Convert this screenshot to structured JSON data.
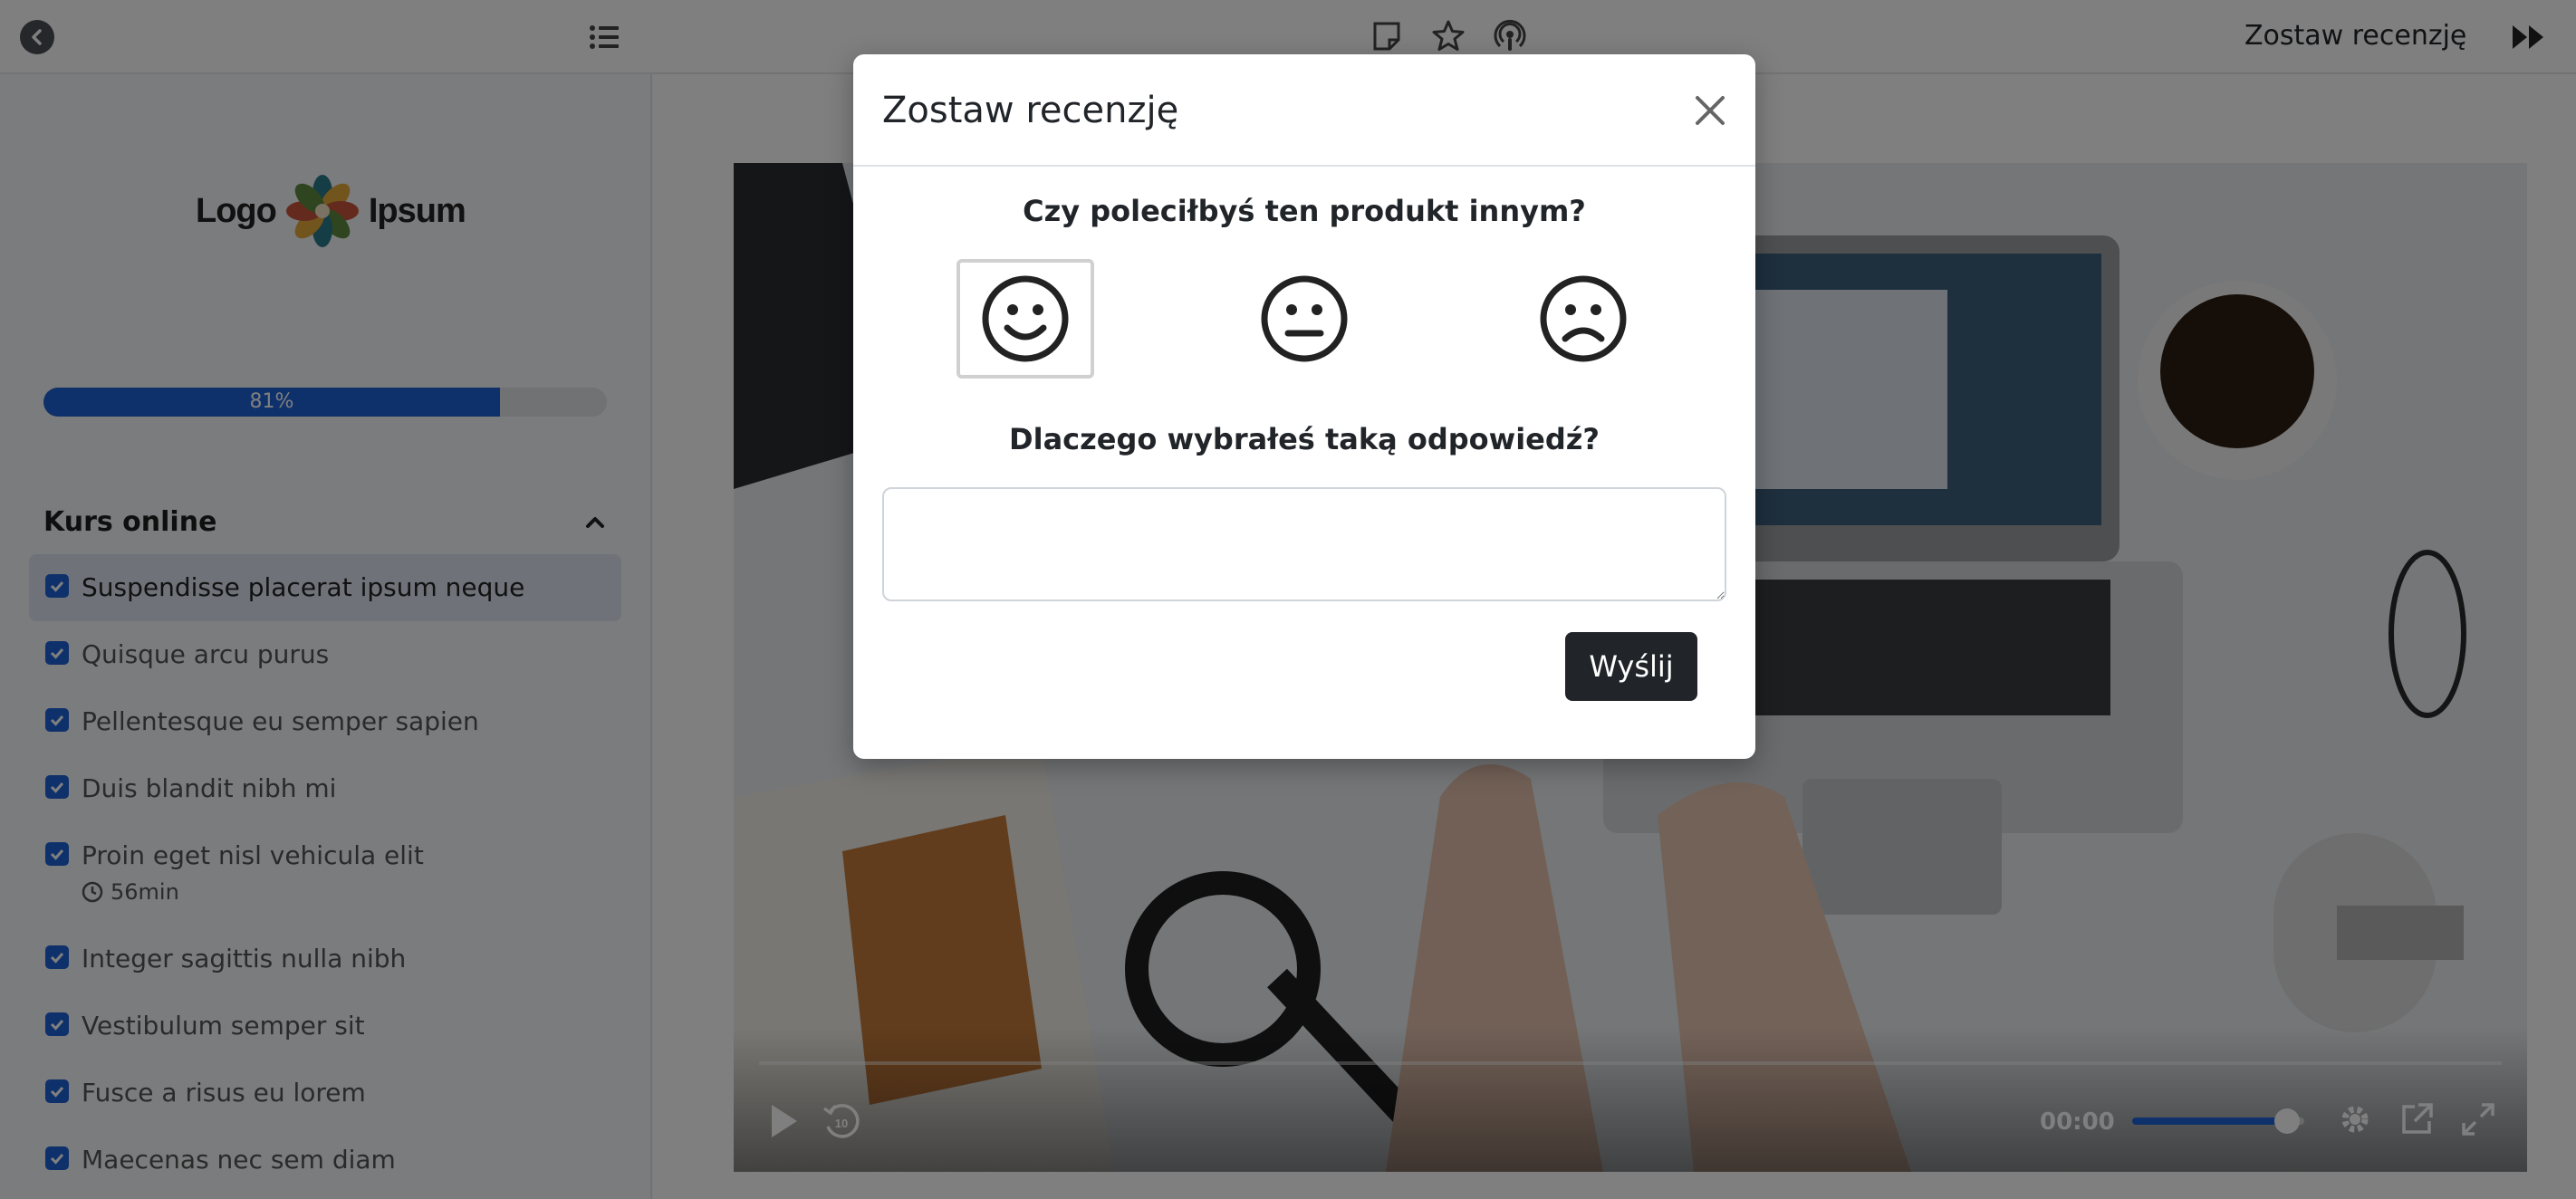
{
  "topbar": {
    "title": "Zostaw recenzję",
    "icons": [
      "back-arrow-icon",
      "list-icon",
      "note-icon",
      "star-icon",
      "podcast-icon",
      "forward-icon"
    ]
  },
  "sidebar": {
    "logo": {
      "left": "Logo",
      "right": "Ipsum"
    },
    "progress": {
      "label": "81%",
      "value": 0.81
    },
    "section_title": "Kurs online",
    "lessons": [
      {
        "label": "Suspendisse placerat ipsum neque",
        "done": true
      },
      {
        "label": "Quisque arcu purus",
        "done": true
      },
      {
        "label": "Pellentesque eu semper sapien",
        "done": true
      },
      {
        "label": "Duis blandit nibh mi",
        "done": true
      },
      {
        "label": "Proin eget nisl vehicula elit",
        "done": true,
        "duration": "56min"
      },
      {
        "label": "Integer sagittis nulla nibh",
        "done": true
      },
      {
        "label": "Vestibulum semper sit",
        "done": true
      },
      {
        "label": "Fusce a risus eu lorem",
        "done": true
      },
      {
        "label": "Maecenas nec sem diam",
        "done": true
      }
    ]
  },
  "player": {
    "time": "00:00",
    "volume": 0.9,
    "colors": {
      "accent": "#1e63d6"
    }
  },
  "modal": {
    "title": "Zostaw recenzję",
    "question1": "Czy poleciłbyś ten produkt innym?",
    "faces": [
      "smile-face-icon",
      "neutral-face-icon",
      "sad-face-icon"
    ],
    "selected_face": "smile-face-icon",
    "question2": "Dlaczego wybrałeś taką odpowiedź?",
    "answer_value": "",
    "submit_label": "Wyślij"
  }
}
